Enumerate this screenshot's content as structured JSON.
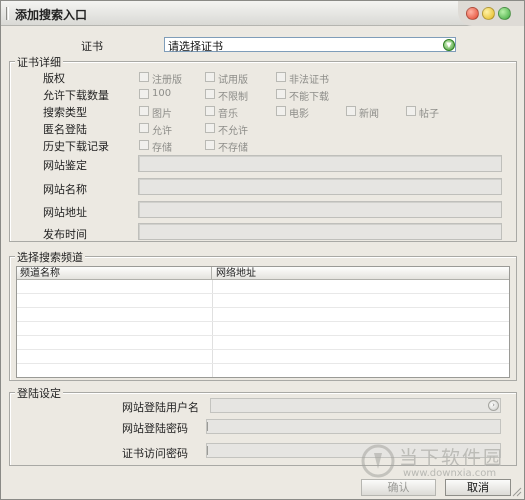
{
  "window": {
    "title": "添加搜索入口"
  },
  "certificate": {
    "label": "证书",
    "value": "请选择证书"
  },
  "cert_details": {
    "section_title": "证书详细",
    "rows": [
      {
        "label": "版权",
        "options": [
          "注册版",
          "试用版",
          "非法证书"
        ]
      },
      {
        "label": "允许下载数量",
        "options": [
          "100",
          "不限制",
          "不能下载"
        ]
      },
      {
        "label": "搜索类型",
        "options": [
          "图片",
          "音乐",
          "电影",
          "新闻",
          "帖子"
        ]
      },
      {
        "label": "匿名登陆",
        "options": [
          "允许",
          "不允许"
        ]
      },
      {
        "label": "历史下载记录",
        "options": [
          "存储",
          "不存储"
        ]
      }
    ],
    "fields": [
      {
        "label": "网站鉴定",
        "value": ""
      },
      {
        "label": "网站名称",
        "value": ""
      },
      {
        "label": "网站地址",
        "value": ""
      },
      {
        "label": "发布时间",
        "value": ""
      }
    ]
  },
  "channels": {
    "section_title": "选择搜索频道",
    "columns": [
      "频道名称",
      "网络地址"
    ],
    "rows": []
  },
  "login": {
    "section_title": "登陆设定",
    "username_label": "网站登陆用户名",
    "password_label": "网站登陆密码",
    "cert_password_label": "证书访问密码",
    "username": "",
    "password": "",
    "cert_password": ""
  },
  "buttons": {
    "confirm": "确认",
    "cancel": "取消"
  },
  "watermark": {
    "title": "当下软件园",
    "url": "www.downxia.com"
  },
  "icons": {
    "cert_dropdown": "chevron-down-icon",
    "username_dropdown": "chevron-right-icon",
    "window_close": "close-dot-icon",
    "window_minimize": "minimize-dot-icon",
    "window_maximize": "maximize-dot-icon"
  },
  "colors": {
    "window_bg": "#ece9e2",
    "accent_green": "#3f9c2e",
    "disabled_text": "#8d8d89"
  }
}
